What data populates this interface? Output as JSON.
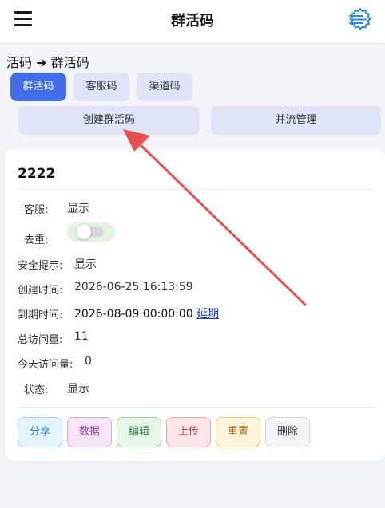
{
  "header": {
    "title": "群活码",
    "menu_icon": "hamburger-menu-icon",
    "settings_icon": "settings-gear-icon"
  },
  "breadcrumb": {
    "text": "活码 ➜ 群活码"
  },
  "tabs": [
    {
      "label": "群活码",
      "active": true
    },
    {
      "label": "客服码",
      "active": false
    },
    {
      "label": "渠道码",
      "active": false
    }
  ],
  "actions": {
    "create_label": "创建群活码",
    "merge_label": "并流管理"
  },
  "card": {
    "title": "2222",
    "rows": {
      "service": {
        "label": "客服:",
        "value": "显示"
      },
      "dedupe": {
        "label": "去重:",
        "enabled": false
      },
      "safety": {
        "label": "安全提示:",
        "value": "显示"
      },
      "created": {
        "label": "创建时间:",
        "value": "2026-06-25 16:13:59"
      },
      "expire": {
        "label": "到期时间:",
        "value": "2026-08-09 00:00:00",
        "link": "延期"
      },
      "total_visits": {
        "label": "总访问量:",
        "value": "11"
      },
      "today_visits": {
        "label": "今天访问量:",
        "value": "0"
      },
      "status": {
        "label": "状态:",
        "value": "显示"
      }
    },
    "buttons": {
      "share": "分享",
      "data": "数据",
      "edit": "编辑",
      "upload": "上传",
      "reset": "重置",
      "delete": "删除"
    }
  },
  "colors": {
    "accent": "#3f6ee8",
    "annotation_arrow": "#e8504f"
  }
}
